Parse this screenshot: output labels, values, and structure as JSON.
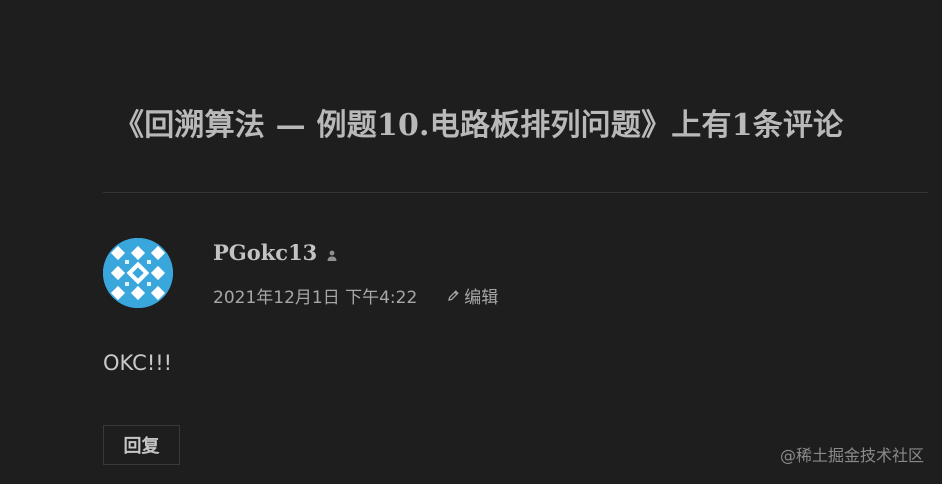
{
  "comments_section": {
    "title": "《回溯算法 — 例题10.电路板排列问题》上有1条评论"
  },
  "comment": {
    "author_name": "PGokc13",
    "timestamp": "2021年12月1日 下午4:22",
    "edit_label": "编辑",
    "body": "OKC!!!",
    "reply_label": "回复",
    "avatar_color": "#39a7dc",
    "icons": {
      "author": "user-icon",
      "edit": "pencil-icon"
    }
  },
  "watermark": {
    "text": "@稀土掘金技术社区"
  }
}
